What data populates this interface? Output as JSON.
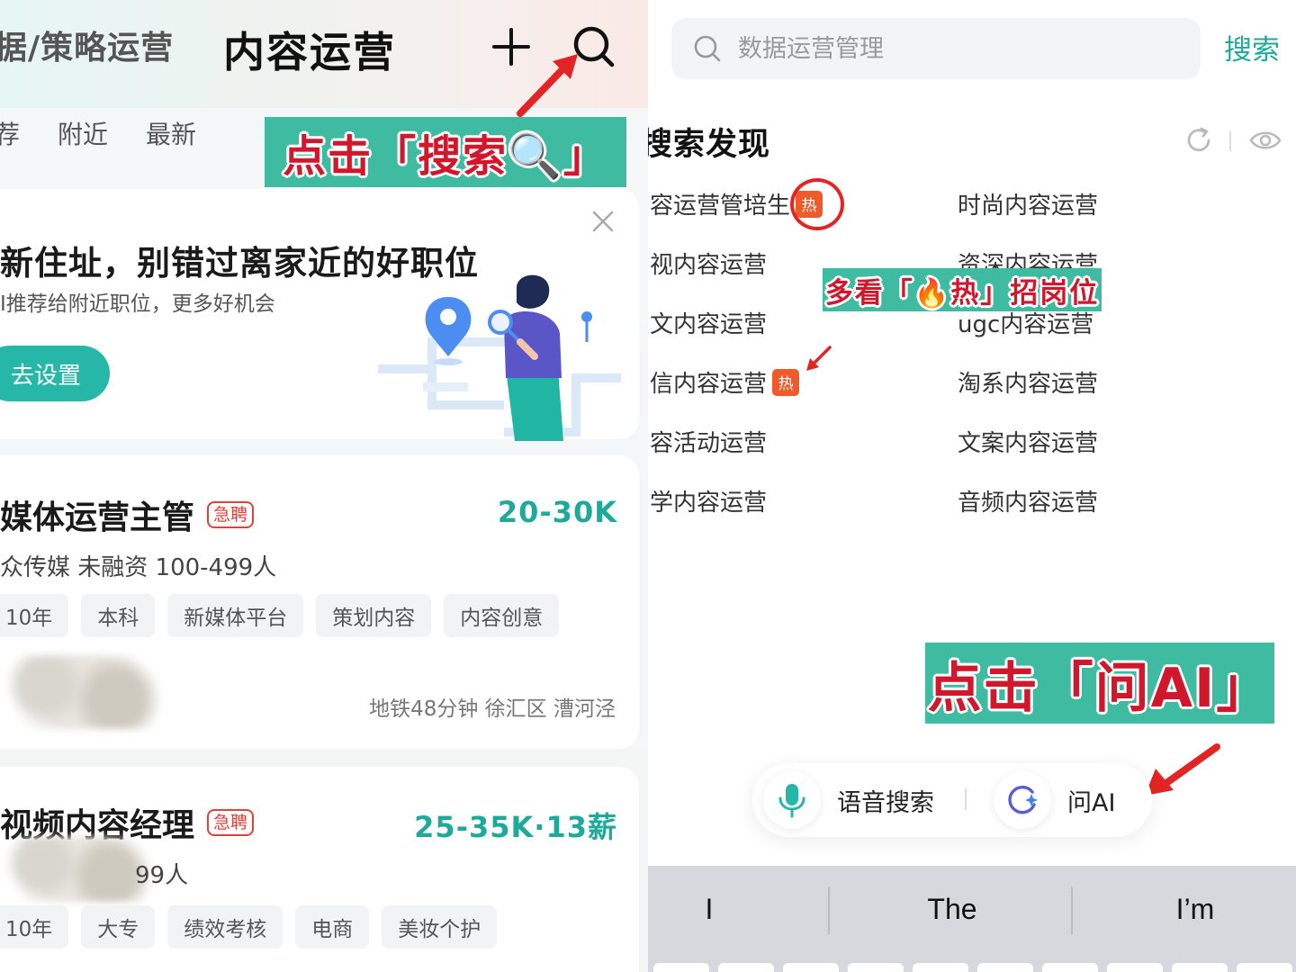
{
  "left": {
    "top_tabs": {
      "muted": "据/策略运营",
      "active": "内容运营"
    },
    "sub_tabs": [
      "荐",
      "附近",
      "最新"
    ],
    "overlay_search": "点击「搜索🔍」",
    "promo": {
      "title": "新住址，别错过离家近的好职位",
      "subtitle": "I推荐给附近职位，更多好机会",
      "button": "去设置"
    },
    "jobs": [
      {
        "title": "媒体运营主管",
        "badge": "急聘",
        "salary": "20-30K",
        "company": "众传媒 未融资 100-499人",
        "tags": [
          "10年",
          "本科",
          "新媒体平台",
          "策划内容",
          "内容创意"
        ],
        "location": "地铁48分钟 徐汇区 漕河泾"
      },
      {
        "title": "视频内容经理",
        "badge": "急聘",
        "salary": "25-35K·13薪",
        "company": "99人",
        "tags": [
          "10年",
          "大专",
          "绩效考核",
          "电商",
          "美妆个护"
        ]
      }
    ]
  },
  "right": {
    "search": {
      "placeholder": "数据运营管理",
      "submit": "搜索"
    },
    "discover_title": "搜索发现",
    "hot_label": "热",
    "keywords_left": [
      {
        "text": "容运营管培生",
        "hot": true
      },
      {
        "text": "视内容运营",
        "hot": false
      },
      {
        "text": "文内容运营",
        "hot": false
      },
      {
        "text": "信内容运营",
        "hot": true
      },
      {
        "text": "容活动运营",
        "hot": false
      },
      {
        "text": "学内容运营",
        "hot": false
      }
    ],
    "keywords_right": [
      "时尚内容运营",
      "资深内容运营",
      "ugc内容运营",
      "淘系内容运营",
      "文案内容运营",
      "音频内容运营"
    ],
    "overlay_hot": "多看「🔥热」招岗位",
    "overlay_ai": "点击「问AI」",
    "voice_search": "语音搜索",
    "ask_ai": "问AI",
    "suggestions": [
      "I",
      "The",
      "I’m"
    ]
  },
  "colors": {
    "accent": "#1fa99b",
    "button": "#27b7a8",
    "overlay_bg": "#3fbba1",
    "overlay_text": "#d2162b",
    "hot": "#ef5a2a",
    "arrow": "#e32424"
  },
  "icons": [
    "plus-icon",
    "search-icon",
    "close-icon",
    "location-pin-icon",
    "refresh-icon",
    "eye-icon",
    "microphone-icon",
    "ai-sparkle-icon",
    "red-arrow"
  ]
}
